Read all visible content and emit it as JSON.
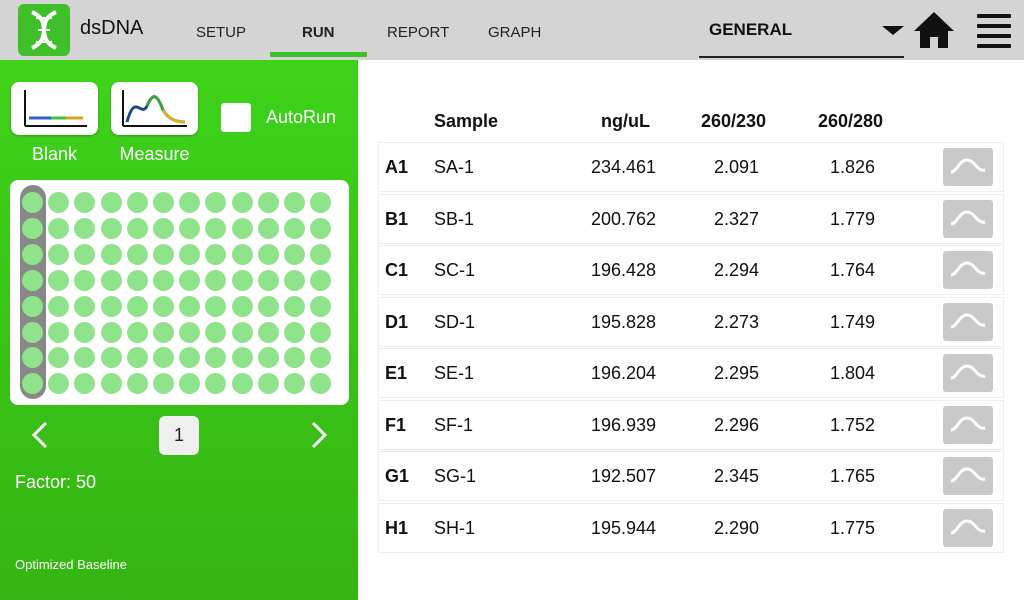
{
  "header": {
    "app_title": "dsDNA",
    "tabs": [
      {
        "label": "SETUP",
        "active": false
      },
      {
        "label": "RUN",
        "active": true
      },
      {
        "label": "REPORT",
        "active": false
      },
      {
        "label": "GRAPH",
        "active": false
      }
    ],
    "mode_select": "GENERAL",
    "icons": {
      "logo": "dna-helix-icon",
      "home": "home-icon",
      "menu": "hamburger-menu-icon"
    }
  },
  "left_panel": {
    "blank_label": "Blank",
    "measure_label": "Measure",
    "autorun_label": "AutoRun",
    "autorun_checked": false,
    "plate": {
      "rows": 8,
      "columns": 12,
      "selected_column": 1
    },
    "page_number": "1",
    "factor": "Factor: 50",
    "baseline_text": "Optimized Baseline"
  },
  "table": {
    "columns": [
      "Sample",
      "ng/uL",
      "260/230",
      "260/280"
    ],
    "rows": [
      {
        "well": "A1",
        "sample": "SA-1",
        "conc": "234.461",
        "r230": "2.091",
        "r280": "1.826"
      },
      {
        "well": "B1",
        "sample": "SB-1",
        "conc": "200.762",
        "r230": "2.327",
        "r280": "1.779"
      },
      {
        "well": "C1",
        "sample": "SC-1",
        "conc": "196.428",
        "r230": "2.294",
        "r280": "1.764"
      },
      {
        "well": "D1",
        "sample": "SD-1",
        "conc": "195.828",
        "r230": "2.273",
        "r280": "1.749"
      },
      {
        "well": "E1",
        "sample": "SE-1",
        "conc": "196.204",
        "r230": "2.295",
        "r280": "1.804"
      },
      {
        "well": "F1",
        "sample": "SF-1",
        "conc": "196.939",
        "r230": "2.296",
        "r280": "1.752"
      },
      {
        "well": "G1",
        "sample": "SG-1",
        "conc": "192.507",
        "r230": "2.345",
        "r280": "1.765"
      },
      {
        "well": "H1",
        "sample": "SH-1",
        "conc": "195.944",
        "r230": "2.290",
        "r280": "1.775"
      }
    ]
  },
  "colors": {
    "accent_green": "#3fbf2a",
    "well_green": "#8fe38a",
    "topbar_gray": "#d4d4d4"
  }
}
